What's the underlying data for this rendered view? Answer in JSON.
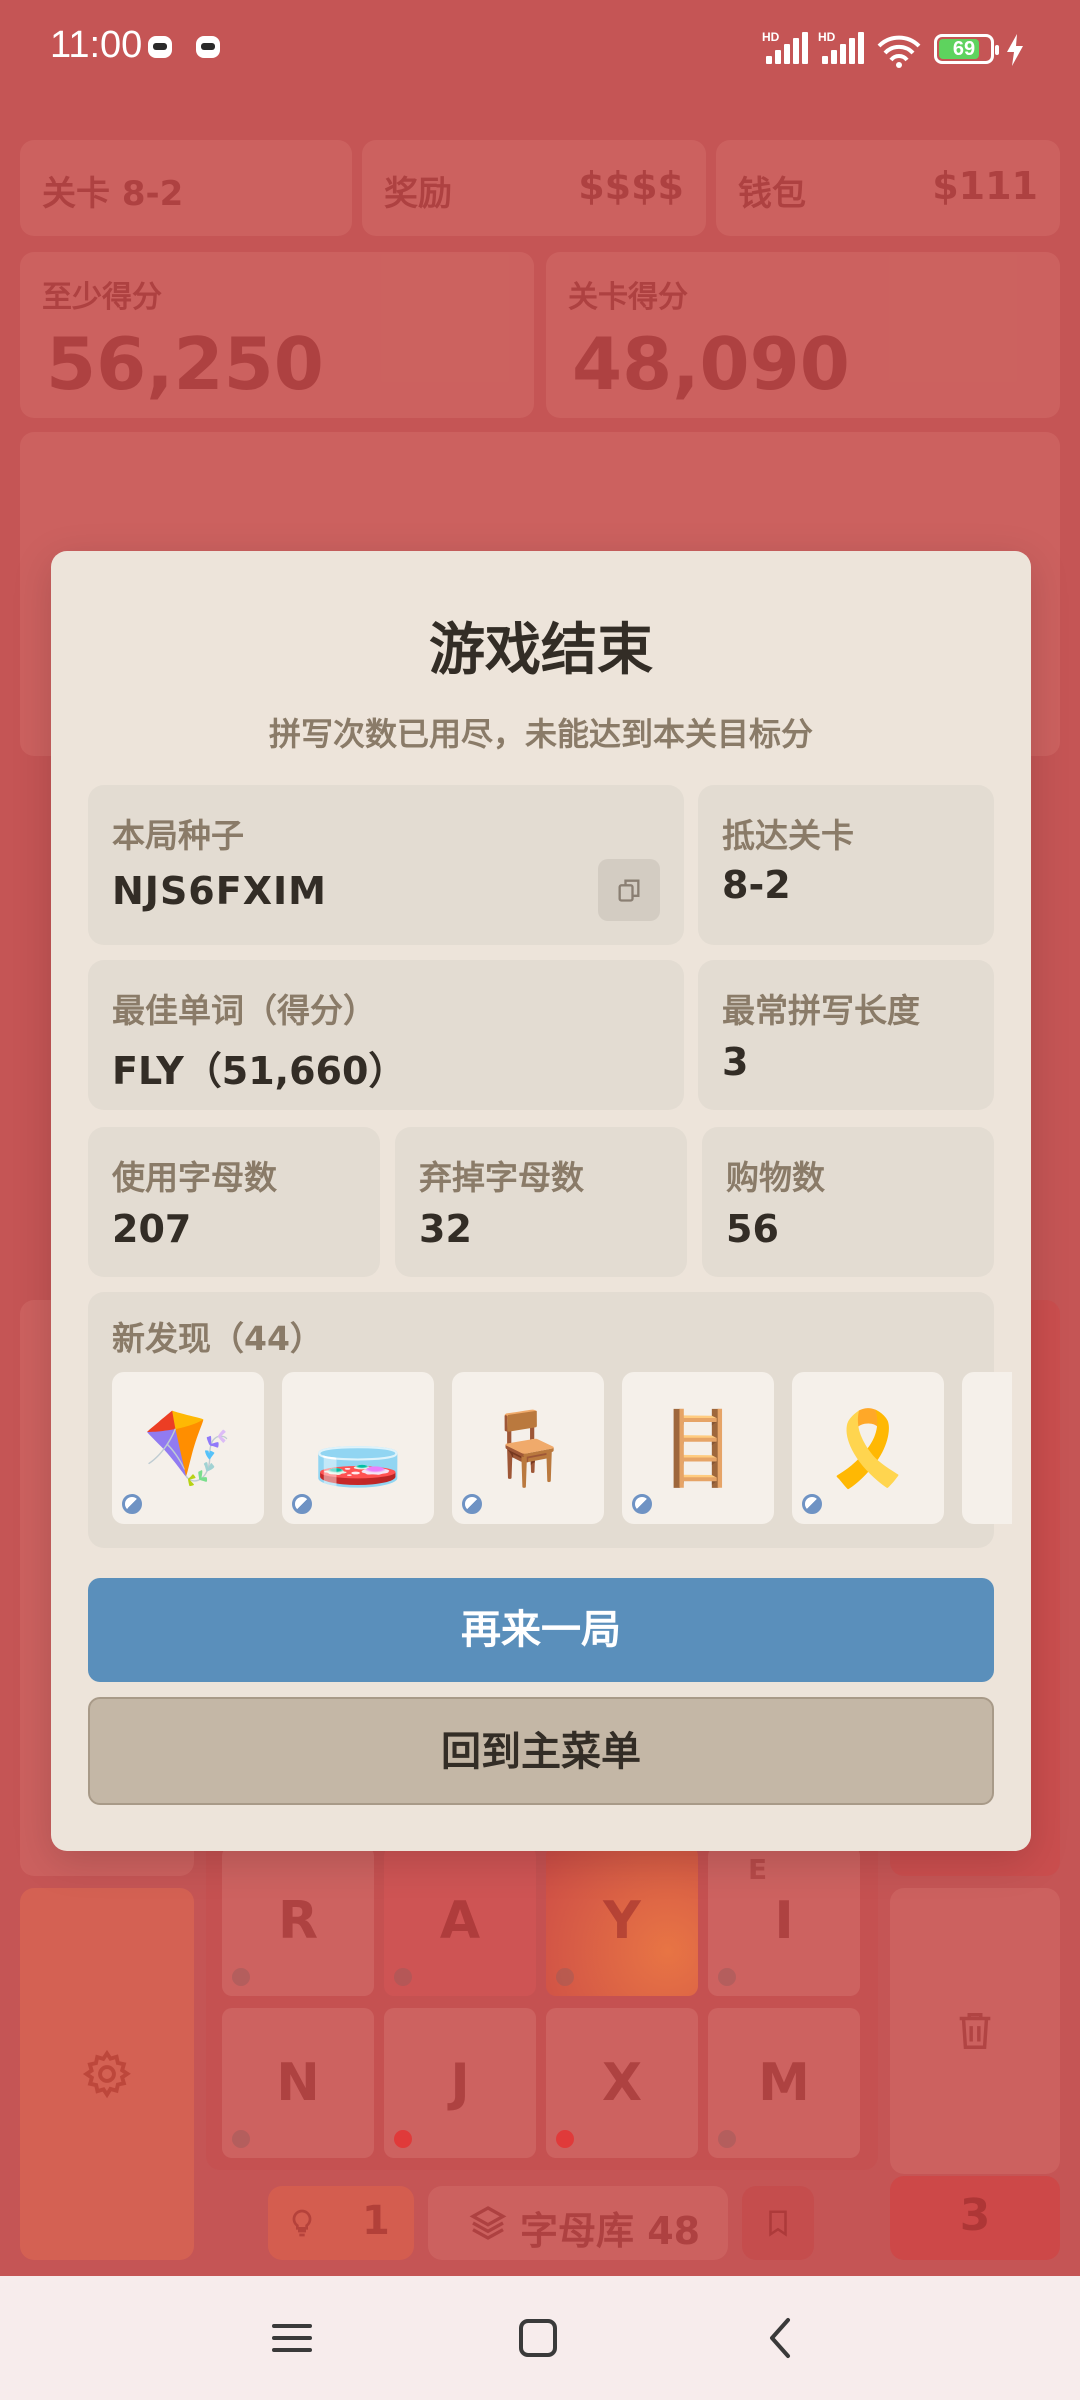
{
  "status_bar": {
    "time": "11:00",
    "battery_level": "69"
  },
  "background": {
    "level_label": "关卡 8-2",
    "reward_label": "奖励",
    "reward_value": "$$$$",
    "wallet_label": "钱包",
    "wallet_value": "$111",
    "min_score_label": "至少得分",
    "min_score_value": "56,250",
    "level_score_label": "关卡得分",
    "level_score_value": "48,090",
    "tiles": [
      {
        "letter": "R",
        "superscript": ""
      },
      {
        "letter": "A",
        "superscript": ""
      },
      {
        "letter": "Y",
        "superscript": ""
      },
      {
        "letter": "I",
        "superscript": "E"
      },
      {
        "letter": "N",
        "superscript": ""
      },
      {
        "letter": "J",
        "superscript": ""
      },
      {
        "letter": "X",
        "superscript": ""
      },
      {
        "letter": "M",
        "superscript": ""
      }
    ],
    "hint_count": "1",
    "letter_bank_label": "字母库 48",
    "discard_count": "3"
  },
  "modal": {
    "title": "游戏结束",
    "subtitle": "拼写次数已用尽，未能达到本关目标分",
    "seed_label": "本局种子",
    "seed_value": "NJS6FXIM",
    "reached_level_label": "抵达关卡",
    "reached_level_value": "8-2",
    "best_word_label": "最佳单词（得分）",
    "best_word_value": "FLY（51,660）",
    "common_length_label": "最常拼写长度",
    "common_length_value": "3",
    "letters_used_label": "使用字母数",
    "letters_used_value": "207",
    "letters_discarded_label": "弃掉字母数",
    "letters_discarded_value": "32",
    "purchases_label": "购物数",
    "purchases_value": "56",
    "discoveries_label": "新发现（44）",
    "discoveries": [
      {
        "emoji": "🪁",
        "icon": "kite-icon"
      },
      {
        "emoji": "🧫",
        "icon": "petri-dish-icon"
      },
      {
        "emoji": "🪑",
        "icon": "chair-icon"
      },
      {
        "emoji": "🪜",
        "icon": "ladder-icon"
      },
      {
        "emoji": "🎗️",
        "icon": "ribbon-icon"
      }
    ],
    "play_again_label": "再来一局",
    "main_menu_label": "回到主菜单"
  },
  "colors": {
    "backdrop": "#c55555",
    "modal_bg": "#ede4da",
    "panel_bg": "#e3dcd2",
    "primary_button": "#5a8fbb",
    "secondary_button": "#c4b7a6"
  }
}
